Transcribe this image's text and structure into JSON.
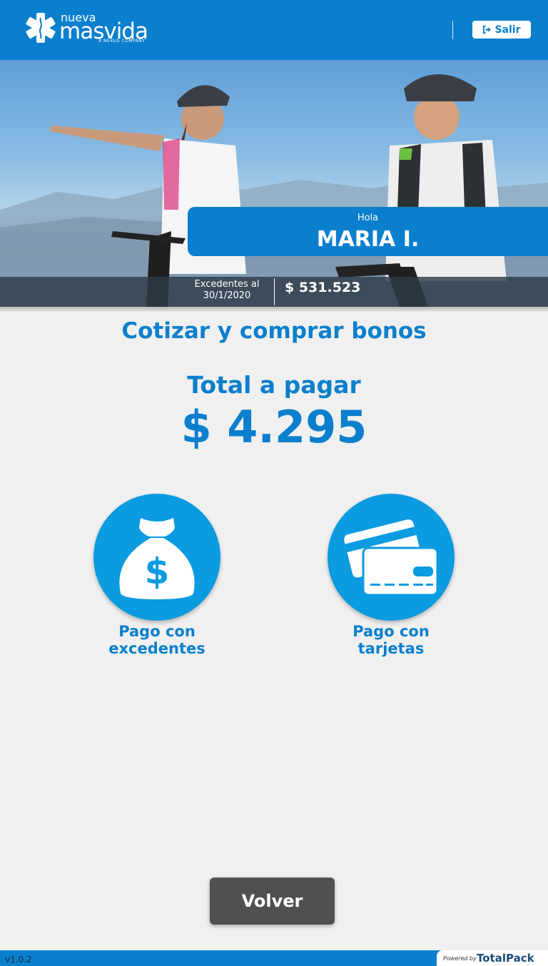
{
  "header": {
    "logo": {
      "line1": "nueva",
      "line2": "masvida",
      "tagline": "A NEXUS COMPANY"
    },
    "logout_label": "Salir"
  },
  "hero": {
    "greeting": "Hola",
    "user_name": "MARIA I.",
    "excedentes_label": "Excedentes al",
    "excedentes_date": "30/1/2020",
    "excedentes_value": "$ 531.523"
  },
  "main": {
    "title": "Cotizar y comprar bonos",
    "total_label": "Total a pagar",
    "total_value": "$ 4.295",
    "payment_options": [
      {
        "label_line1": "Pago con",
        "label_line2": "excedentes",
        "icon": "money-bag-icon"
      },
      {
        "label_line1": "Pago con",
        "label_line2": "tarjetas",
        "icon": "credit-cards-icon"
      }
    ]
  },
  "back_button_label": "Volver",
  "footer": {
    "version": "v1.0.2",
    "powered_by": "Powered by",
    "brand": "TotalPack"
  },
  "colors": {
    "primary": "#0a7fcd",
    "circle": "#0a9be0",
    "button": "#505050",
    "background": "#f0f0f0"
  }
}
